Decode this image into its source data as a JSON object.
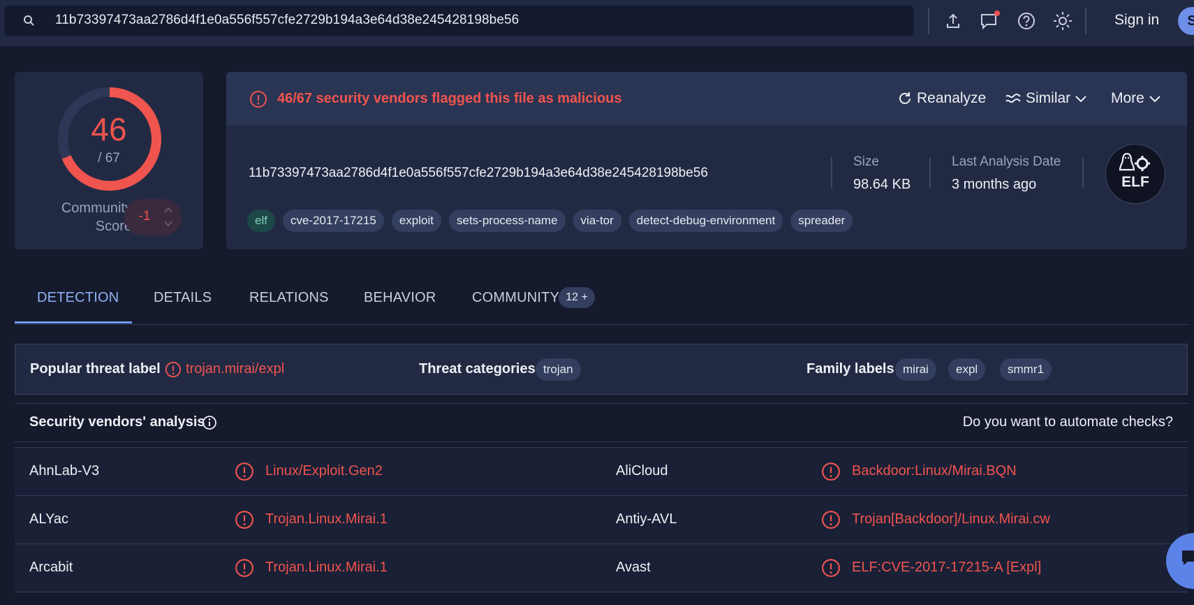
{
  "search": {
    "query": "11b73397473aa2786d4f1e0a556f557cfe2729b194a3e64d38e245428198be56"
  },
  "header": {
    "sign_in": "Sign in",
    "avatar_letter": "S"
  },
  "score": {
    "detections": "46",
    "total": "/ 67",
    "community_label": "Community Score",
    "community_value": "-1"
  },
  "alert": {
    "text": "46/67 security vendors flagged this file as malicious"
  },
  "actions": {
    "reanalyze": "Reanalyze",
    "similar": "Similar",
    "more": "More"
  },
  "file": {
    "hash": "11b73397473aa2786d4f1e0a556f557cfe2729b194a3e64d38e245428198be56",
    "size_label": "Size",
    "size_value": "98.64 KB",
    "date_label": "Last Analysis Date",
    "date_value": "3 months ago",
    "type_badge": "ELF",
    "tags": [
      "elf",
      "cve-2017-17215",
      "exploit",
      "sets-process-name",
      "via-tor",
      "detect-debug-environment",
      "spreader"
    ]
  },
  "tabs": [
    "DETECTION",
    "DETAILS",
    "RELATIONS",
    "BEHAVIOR",
    "COMMUNITY"
  ],
  "community_badge": "12 +",
  "threat": {
    "popular_label": "Popular threat label",
    "popular_value": "trojan.mirai/expl",
    "categories_label": "Threat categories",
    "categories": [
      "trojan"
    ],
    "family_label": "Family labels",
    "families": [
      "mirai",
      "expl",
      "smmr1"
    ]
  },
  "vendors": {
    "title": "Security vendors' analysis",
    "automate": "Do you want to automate checks?",
    "rows": [
      {
        "v1": "AhnLab-V3",
        "r1": "Linux/Exploit.Gen2",
        "v2": "AliCloud",
        "r2": "Backdoor:Linux/Mirai.BQN"
      },
      {
        "v1": "ALYac",
        "r1": "Trojan.Linux.Mirai.1",
        "v2": "Antiy-AVL",
        "r2": "Trojan[Backdoor]/Linux.Mirai.cw"
      },
      {
        "v1": "Arcabit",
        "r1": "Trojan.Linux.Mirai.1",
        "v2": "Avast",
        "r2": "ELF:CVE-2017-17215-A [Expl]"
      }
    ]
  },
  "colors": {
    "malicious": "#f0544e",
    "accent": "#6f9cf2",
    "bg": "#151a2d",
    "card": "#222a43"
  }
}
